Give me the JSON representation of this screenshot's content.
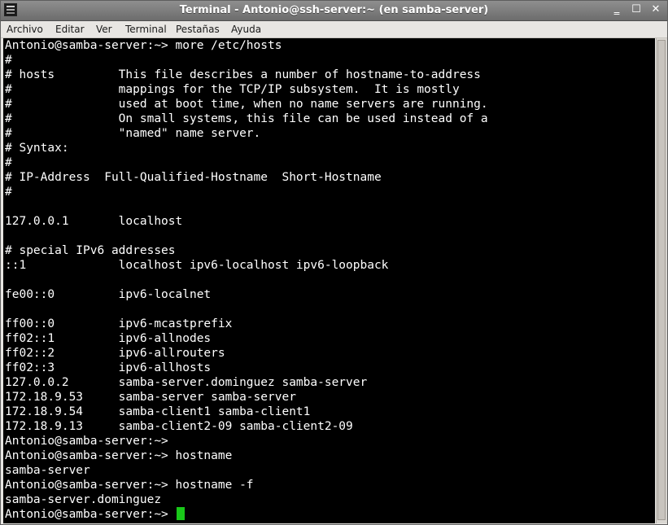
{
  "window": {
    "title": "Terminal - Antonio@ssh-server:~ (en samba-server)",
    "minimize_label": "‗",
    "maximize_label": "☐",
    "close_label": "✕"
  },
  "menu": {
    "items": [
      "Archivo",
      "Editar",
      "Ver",
      "Terminal",
      "Pestañas",
      "Ayuda"
    ]
  },
  "terminal": {
    "lines": [
      "Antonio@samba-server:~> more /etc/hosts",
      "#",
      "# hosts         This file describes a number of hostname-to-address",
      "#               mappings for the TCP/IP subsystem.  It is mostly",
      "#               used at boot time, when no name servers are running.",
      "#               On small systems, this file can be used instead of a",
      "#               \"named\" name server.",
      "# Syntax:",
      "#",
      "# IP-Address  Full-Qualified-Hostname  Short-Hostname",
      "#",
      "",
      "127.0.0.1       localhost",
      "",
      "# special IPv6 addresses",
      "::1             localhost ipv6-localhost ipv6-loopback",
      "",
      "fe00::0         ipv6-localnet",
      "",
      "ff00::0         ipv6-mcastprefix",
      "ff02::1         ipv6-allnodes",
      "ff02::2         ipv6-allrouters",
      "ff02::3         ipv6-allhosts",
      "127.0.0.2       samba-server.dominguez samba-server",
      "172.18.9.53     samba-server samba-server",
      "172.18.9.54     samba-client1 samba-client1",
      "172.18.9.13     samba-client2-09 samba-client2-09",
      "Antonio@samba-server:~>",
      "Antonio@samba-server:~> hostname",
      "samba-server",
      "Antonio@samba-server:~> hostname -f",
      "samba-server.dominguez"
    ],
    "prompt": "Antonio@samba-server:~> ",
    "cursor_color": "#19c819",
    "background": "#000000",
    "foreground": "#ffffff"
  }
}
